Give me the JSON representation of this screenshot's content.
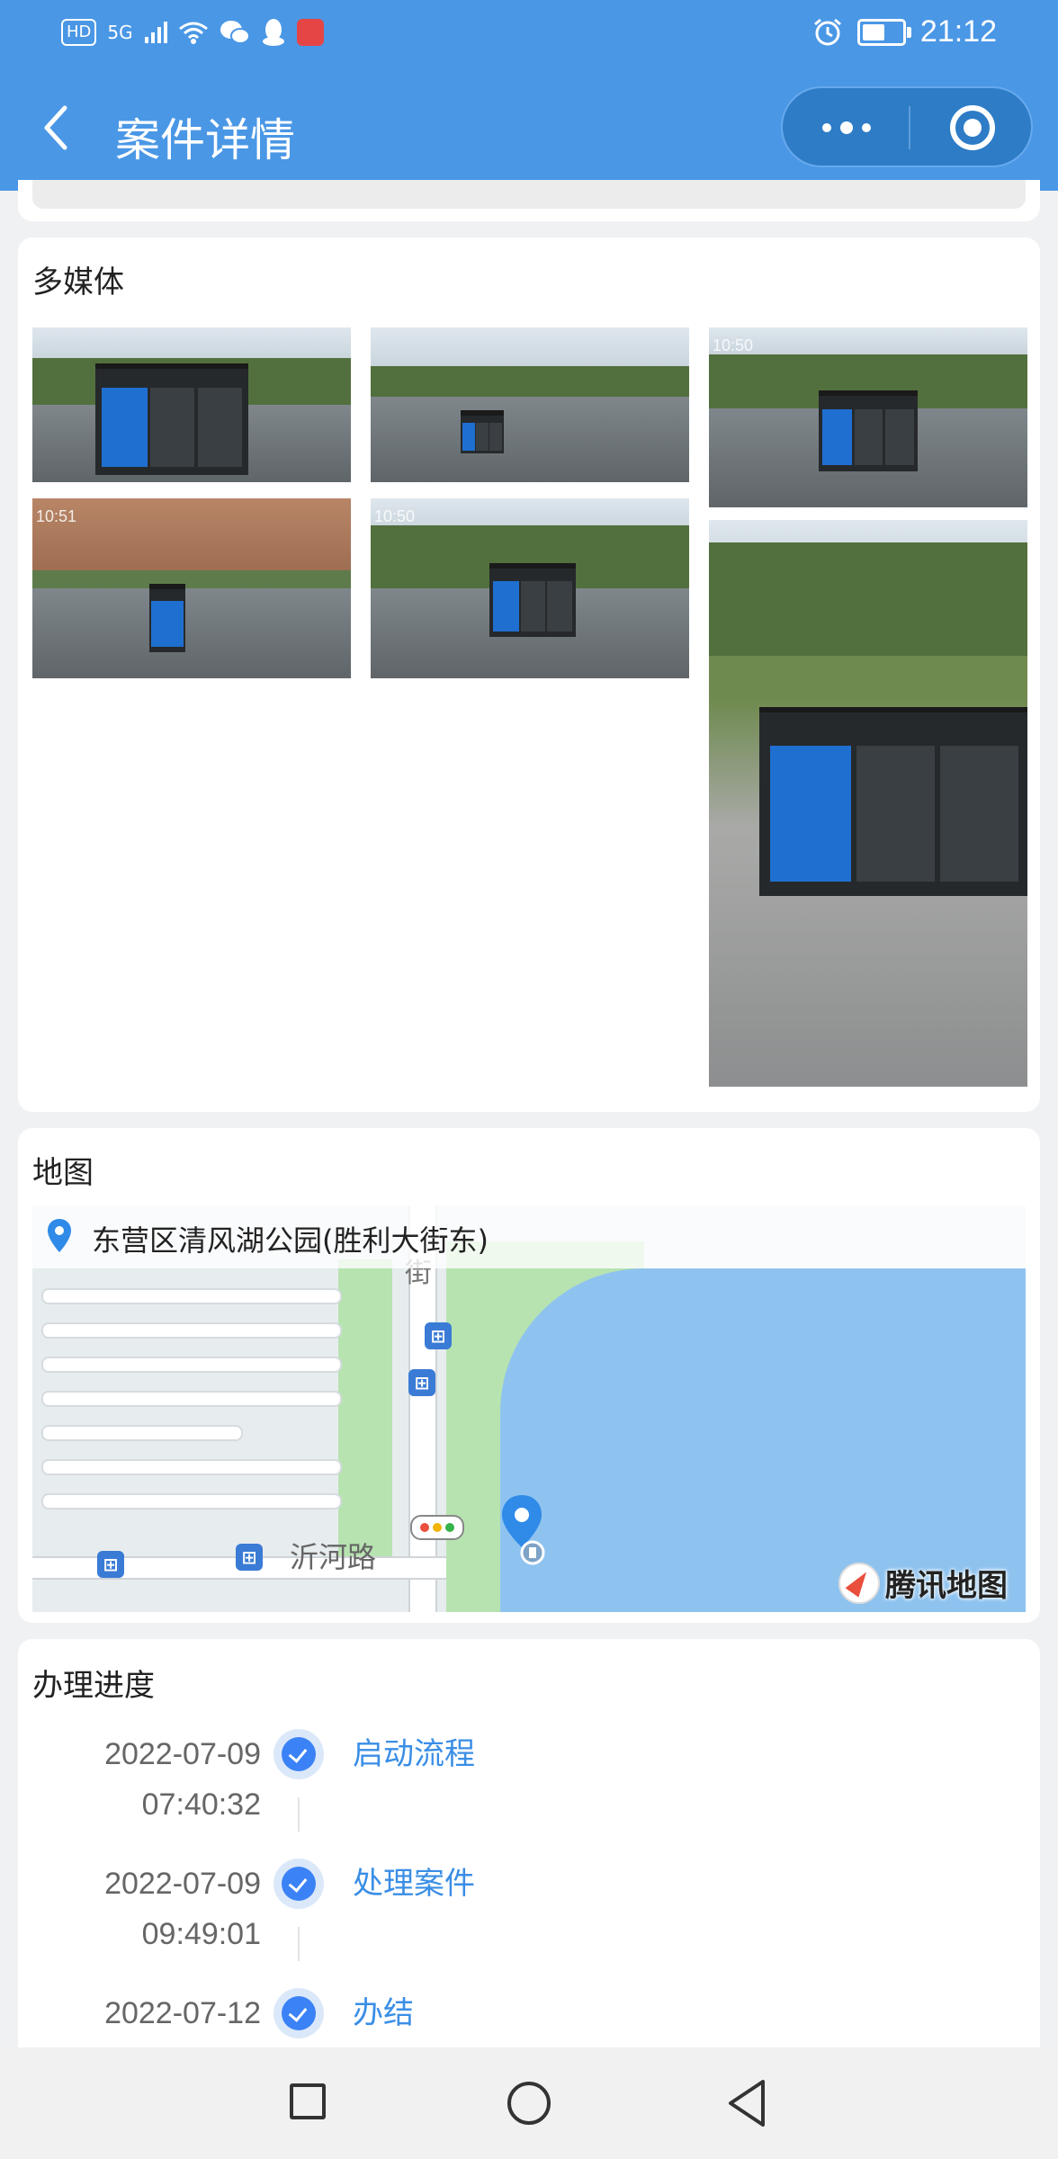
{
  "status_bar": {
    "time": "21:12",
    "hd": "HD",
    "network": "5G",
    "battery_level": 0.6,
    "icons": [
      "hd-icon",
      "signal-icon",
      "wifi-icon",
      "wechat-icon",
      "qq-icon",
      "notification-icon",
      "alarm-icon",
      "battery-icon"
    ]
  },
  "header": {
    "title": "案件详情"
  },
  "media": {
    "title": "多媒体",
    "photos": [
      {
        "stamp": ""
      },
      {
        "stamp": ""
      },
      {
        "stamp": "10:50"
      },
      {
        "stamp": "10:51"
      },
      {
        "stamp": "10:50"
      },
      {
        "stamp": ""
      }
    ]
  },
  "map": {
    "title": "地图",
    "address": "东营区清风湖公园(胜利大街东)",
    "road_label": "沂河路",
    "road_label_vertical": "街",
    "provider": "腾讯地图"
  },
  "progress": {
    "title": "办理进度",
    "steps": [
      {
        "date": "2022-07-09",
        "time": "07:40:32",
        "label": "启动流程"
      },
      {
        "date": "2022-07-09",
        "time": "09:49:01",
        "label": "处理案件"
      },
      {
        "date": "2022-07-12",
        "time": "",
        "label": "办结"
      }
    ]
  },
  "colors": {
    "header_bg": "#4a97e6",
    "accent": "#3a8ee6",
    "check": "#3b82f6"
  }
}
